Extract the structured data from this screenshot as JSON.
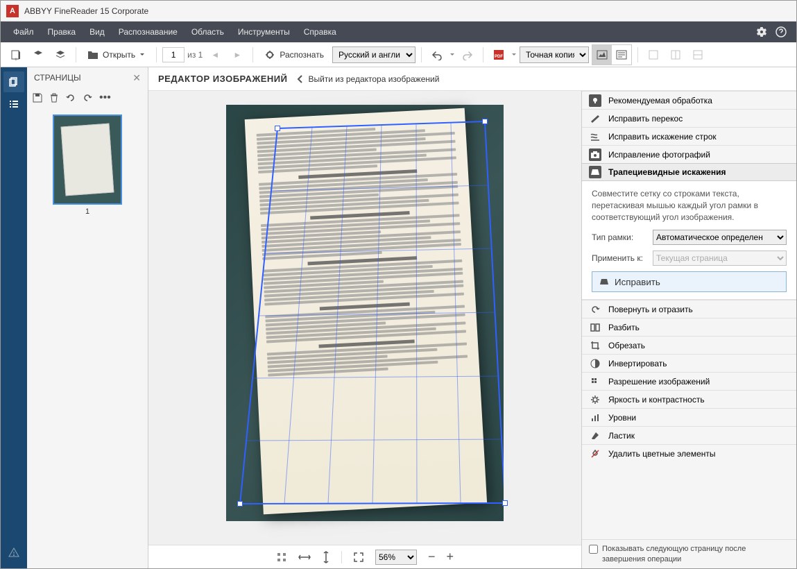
{
  "app": {
    "title": "ABBYY FineReader 15 Corporate"
  },
  "menu": {
    "file": "Файл",
    "edit": "Правка",
    "view": "Вид",
    "recognition": "Распознавание",
    "area": "Область",
    "tools": "Инструменты",
    "help": "Справка"
  },
  "toolbar": {
    "open": "Открыть",
    "page_num": "1",
    "page_total": "из 1",
    "recognize": "Распознать",
    "lang": "Русский и англи",
    "save_mode": "Точная копия"
  },
  "pages_panel": {
    "title": "СТРАНИЦЫ",
    "thumb_num": "1"
  },
  "editor": {
    "title": "РЕДАКТОР ИЗОБРАЖЕНИЙ",
    "back": "Выйти из редактора изображений"
  },
  "tools_panel": {
    "recommended": "Рекомендуемая обработка",
    "deskew": "Исправить перекос",
    "straighten": "Исправить искажение строк",
    "fix_photo": "Исправление фотографий",
    "trapezoid": "Трапециевидные искажения",
    "trapezoid_desc": "Совместите сетку со строками текста, перетаскивая мышью каждый угол рамки в соответствующий угол изображения.",
    "frame_type_label": "Тип рамки:",
    "frame_type_value": "Автоматическое определен",
    "apply_to_label": "Применить к:",
    "apply_to_value": "Текущая страница",
    "fix_button": "Исправить",
    "rotate": "Повернуть и отразить",
    "split": "Разбить",
    "crop": "Обрезать",
    "invert": "Инвертировать",
    "resolution": "Разрешение изображений",
    "brightness": "Яркость и контрастность",
    "levels": "Уровни",
    "eraser": "Ластик",
    "remove_color": "Удалить цветные элементы"
  },
  "bottom": {
    "zoom": "56%"
  },
  "footer": {
    "next_page": "Показывать следующую страницу после завершения операции"
  }
}
